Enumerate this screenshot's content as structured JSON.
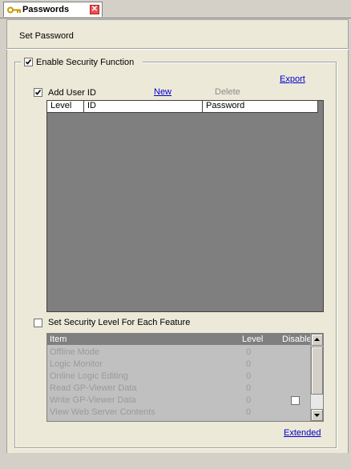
{
  "tab": {
    "label": "Passwords",
    "close": "✕"
  },
  "subtitle": "Set Password",
  "security": {
    "enable_label": "Enable Security Function",
    "enable_checked": true,
    "export_label": "Export"
  },
  "users": {
    "add_label": "Add User ID",
    "add_checked": true,
    "new_label": "New",
    "delete_label": "Delete",
    "columns": [
      "Level",
      "ID",
      "Password"
    ]
  },
  "feature": {
    "label": "Set Security Level For Each Feature",
    "checked": false,
    "columns": [
      "Item",
      "Level",
      "Disable"
    ],
    "rows": [
      {
        "item": "Offline Mode",
        "level": "0"
      },
      {
        "item": "Logic Monitor",
        "level": "0"
      },
      {
        "item": "Online Logic Editing",
        "level": "0"
      },
      {
        "item": "Read GP-Viewer Data",
        "level": "0"
      },
      {
        "item": "Write GP-Viewer Data",
        "level": "0",
        "disable": false
      },
      {
        "item": "View Web Server Contents",
        "level": "0"
      }
    ],
    "extended_label": "Extended"
  }
}
